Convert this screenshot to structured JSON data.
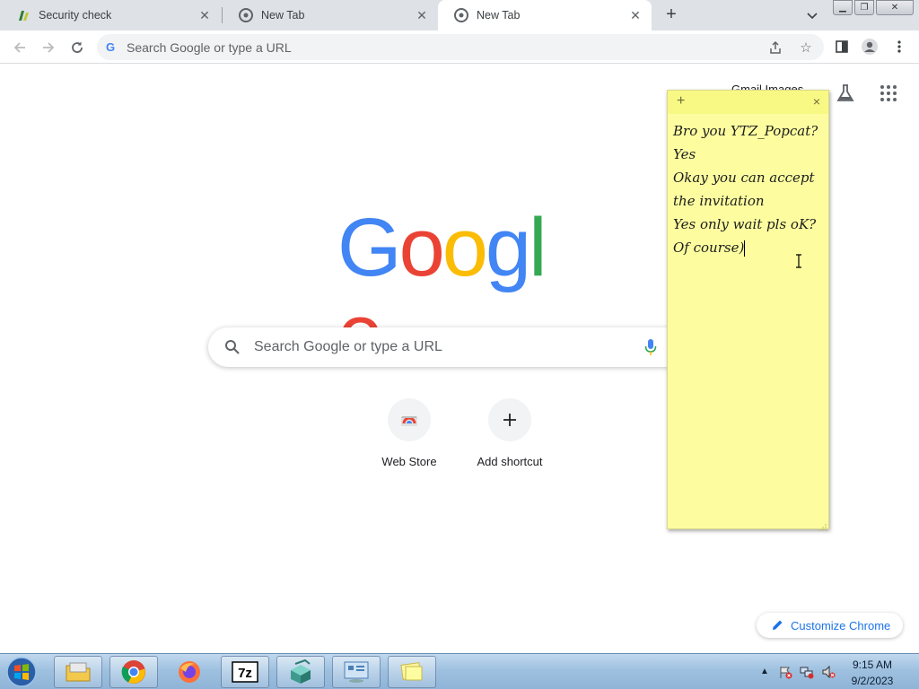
{
  "tabs": [
    {
      "title": "Security check",
      "active": false
    },
    {
      "title": "New Tab",
      "active": false
    },
    {
      "title": "New Tab",
      "active": true
    }
  ],
  "toolbar": {
    "omnibox_placeholder": "Search Google or type a URL"
  },
  "ntp": {
    "top_link": "Gmail  Images",
    "logo_letters": [
      "G",
      "o",
      "o",
      "g",
      "l",
      "e"
    ],
    "logo_colors": [
      "#4285f4",
      "#ea4335",
      "#fbbc05",
      "#4285f4",
      "#34a853",
      "#ea4335"
    ],
    "search_placeholder": "Search Google or type a URL",
    "shortcuts": [
      {
        "label": "Web Store"
      },
      {
        "label": "Add shortcut"
      }
    ],
    "customize_label": "Customize Chrome"
  },
  "sticky_note": {
    "lines": [
      "Bro you YTZ_Popcat?",
      "Yes",
      "Okay you can accept",
      "the invitation",
      "Yes only wait pls oK?",
      "Of course)"
    ],
    "add_symbol": "+",
    "close_symbol": "×"
  },
  "taskbar": {
    "time": "9:15 AM",
    "date": "9/2/2023",
    "apps": [
      "explorer",
      "chrome",
      "firefox",
      "7zip",
      "package",
      "control-panel",
      "sticky-notes"
    ]
  },
  "colors": {
    "accent": "#1a73e8",
    "sticky_bg": "#fdfda0",
    "tabstrip_bg": "#dee1e6"
  }
}
